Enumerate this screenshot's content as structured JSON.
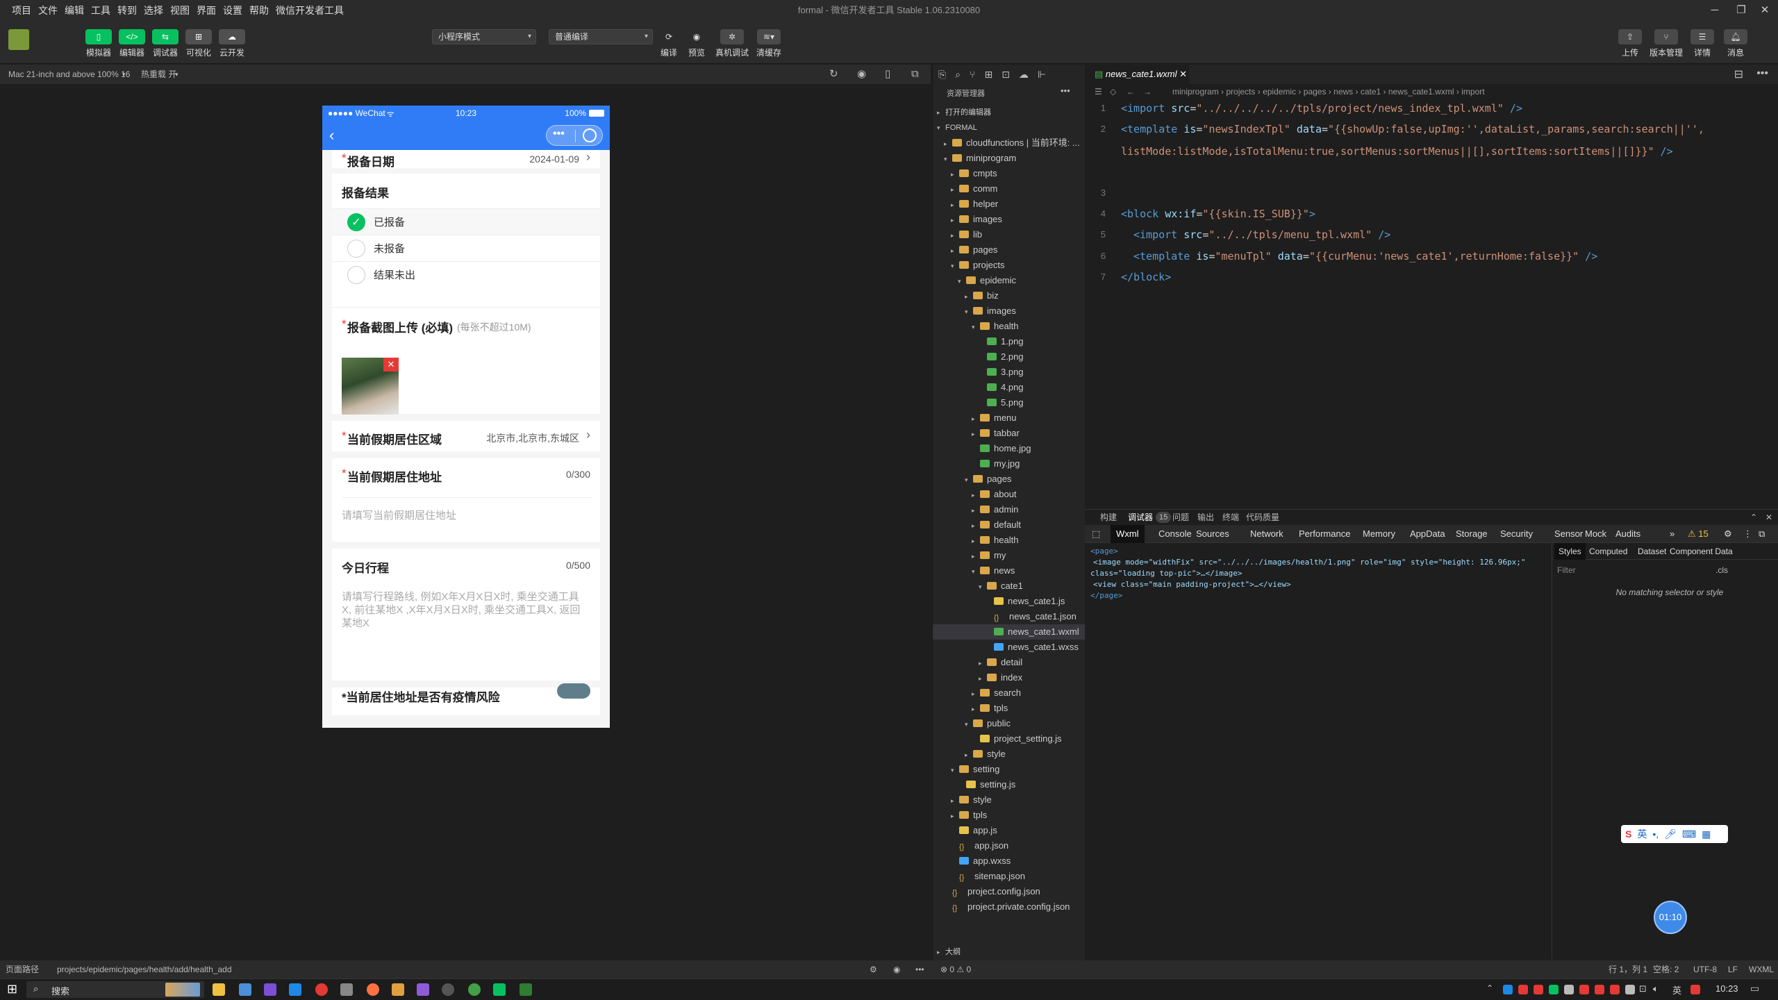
{
  "window": {
    "title": "formal - 微信开发者工具 Stable 1.06.2310080"
  },
  "menu": [
    "项目",
    "文件",
    "编辑",
    "工具",
    "转到",
    "选择",
    "视图",
    "界面",
    "设置",
    "帮助",
    "微信开发者工具"
  ],
  "toolbar": {
    "left_buttons": [
      "模拟器",
      "编辑器",
      "调试器",
      "可视化",
      "云开发"
    ],
    "mode_select": "小程序模式",
    "compile_select": "普通编译",
    "mid_buttons": [
      "编译",
      "预览",
      "真机调试",
      "清缓存"
    ],
    "right_buttons": [
      "上传",
      "版本管理",
      "详情",
      "消息"
    ]
  },
  "simbar": {
    "device": "Mac 21-inch and above 100% 16",
    "hotreload": "热重载 开"
  },
  "phone": {
    "carrier": "●●●●● WeChat",
    "time": "10:23",
    "battery": "100%",
    "date_label": "报备日期",
    "date_value": "2024-01-09",
    "result_label": "报备结果",
    "options": [
      "已报备",
      "未报备",
      "结果未出"
    ],
    "upload_label": "报备截图上传 (必填)",
    "upload_hint": "(每张不超过10M)",
    "region_label": "当前假期居住区域",
    "region_value": "北京市,北京市,东城区",
    "address_label": "当前假期居住地址",
    "address_count": "0/300",
    "address_placeholder": "请填写当前假期居住地址",
    "trip_label": "今日行程",
    "trip_count": "0/500",
    "trip_placeholder": "请填写行程路线, 例如X年X月X日X时, 乘坐交通工具X, 前往某地X ,X年X月X日X时, 乘坐交通工具X, 返回某地X",
    "bottom_partial": "*当前居住地址是否有疫情风险"
  },
  "explorer": {
    "title": "资源管理器",
    "open_editors": "打开的编辑器",
    "root": "FORMAL",
    "outline": "大纲",
    "tree": [
      {
        "d": 1,
        "name": "cloudfunctions | 当前环境: ...",
        "type": "folder",
        "open": false
      },
      {
        "d": 1,
        "name": "miniprogram",
        "type": "folder",
        "open": true
      },
      {
        "d": 2,
        "name": "cmpts",
        "type": "folder",
        "open": false
      },
      {
        "d": 2,
        "name": "comm",
        "type": "folder",
        "open": false
      },
      {
        "d": 2,
        "name": "helper",
        "type": "folder",
        "open": false
      },
      {
        "d": 2,
        "name": "images",
        "type": "folder",
        "open": false
      },
      {
        "d": 2,
        "name": "lib",
        "type": "folder",
        "open": false
      },
      {
        "d": 2,
        "name": "pages",
        "type": "folder",
        "open": false
      },
      {
        "d": 2,
        "name": "projects",
        "type": "folder",
        "open": true
      },
      {
        "d": 3,
        "name": "epidemic",
        "type": "folder",
        "open": true
      },
      {
        "d": 4,
        "name": "biz",
        "type": "folder",
        "open": false
      },
      {
        "d": 4,
        "name": "images",
        "type": "folder",
        "open": true
      },
      {
        "d": 5,
        "name": "health",
        "type": "folder",
        "open": true
      },
      {
        "d": 6,
        "name": "1.png",
        "type": "img"
      },
      {
        "d": 6,
        "name": "2.png",
        "type": "img"
      },
      {
        "d": 6,
        "name": "3.png",
        "type": "img"
      },
      {
        "d": 6,
        "name": "4.png",
        "type": "img"
      },
      {
        "d": 6,
        "name": "5.png",
        "type": "img"
      },
      {
        "d": 5,
        "name": "menu",
        "type": "folder",
        "open": false
      },
      {
        "d": 5,
        "name": "tabbar",
        "type": "folder",
        "open": false
      },
      {
        "d": 5,
        "name": "home.jpg",
        "type": "img"
      },
      {
        "d": 5,
        "name": "my.jpg",
        "type": "img"
      },
      {
        "d": 4,
        "name": "pages",
        "type": "folder",
        "open": true
      },
      {
        "d": 5,
        "name": "about",
        "type": "folder",
        "open": false
      },
      {
        "d": 5,
        "name": "admin",
        "type": "folder",
        "open": false
      },
      {
        "d": 5,
        "name": "default",
        "type": "folder",
        "open": false
      },
      {
        "d": 5,
        "name": "health",
        "type": "folder",
        "open": false
      },
      {
        "d": 5,
        "name": "my",
        "type": "folder",
        "open": false
      },
      {
        "d": 5,
        "name": "news",
        "type": "folder",
        "open": true
      },
      {
        "d": 6,
        "name": "cate1",
        "type": "folder",
        "open": true
      },
      {
        "d": 7,
        "name": "news_cate1.js",
        "type": "js"
      },
      {
        "d": 7,
        "name": "news_cate1.json",
        "type": "json"
      },
      {
        "d": 7,
        "name": "news_cate1.wxml",
        "type": "wxml",
        "selected": true
      },
      {
        "d": 7,
        "name": "news_cate1.wxss",
        "type": "wxss"
      },
      {
        "d": 6,
        "name": "detail",
        "type": "folder",
        "open": false
      },
      {
        "d": 6,
        "name": "index",
        "type": "folder",
        "open": false
      },
      {
        "d": 5,
        "name": "search",
        "type": "folder",
        "open": false
      },
      {
        "d": 5,
        "name": "tpls",
        "type": "folder",
        "open": false
      },
      {
        "d": 4,
        "name": "public",
        "type": "folder",
        "open": true
      },
      {
        "d": 5,
        "name": "project_setting.js",
        "type": "js"
      },
      {
        "d": 4,
        "name": "style",
        "type": "folder",
        "open": false
      },
      {
        "d": 2,
        "name": "setting",
        "type": "folder",
        "open": true
      },
      {
        "d": 3,
        "name": "setting.js",
        "type": "js"
      },
      {
        "d": 2,
        "name": "style",
        "type": "folder",
        "open": false
      },
      {
        "d": 2,
        "name": "tpls",
        "type": "folder",
        "open": false
      },
      {
        "d": 2,
        "name": "app.js",
        "type": "js"
      },
      {
        "d": 2,
        "name": "app.json",
        "type": "json"
      },
      {
        "d": 2,
        "name": "app.wxss",
        "type": "wxss"
      },
      {
        "d": 2,
        "name": "sitemap.json",
        "type": "json"
      },
      {
        "d": 1,
        "name": "project.config.json",
        "type": "json"
      },
      {
        "d": 1,
        "name": "project.private.config.json",
        "type": "json"
      }
    ]
  },
  "editor": {
    "tab": "news_cate1.wxml",
    "breadcrumb": [
      "miniprogram",
      "projects",
      "epidemic",
      "pages",
      "news",
      "cate1",
      "news_cate1.wxml",
      "import"
    ]
  },
  "devtools": {
    "top_tabs": [
      "构建",
      "调试器",
      "问题",
      "输出",
      "终端",
      "代码质量"
    ],
    "badge": "15",
    "tabs": [
      "Wxml",
      "Console",
      "Sources",
      "Network",
      "Performance",
      "Memory",
      "AppData",
      "Storage",
      "Security",
      "Sensor",
      "Mock",
      "Audits"
    ],
    "warn": "⚠ 15",
    "side_tabs": [
      "Styles",
      "Computed",
      "Dataset",
      "Component Data"
    ],
    "filter_placeholder": "Filter",
    "cls": ".cls",
    "no_match": "No matching selector or style",
    "wxml_lines": [
      "<page>",
      "<image mode=\"widthFix\" src=\"../../../images/health/1.png\" role=\"img\" style=\"height: 126.96px;\"",
      "class=\"loading top-pic\">…</image>",
      "<view class=\"main padding-project\">…</view>",
      "</page>"
    ]
  },
  "statusbar": {
    "path_label": "页面路径",
    "path": "projects/epidemic/pages/health/add/health_add",
    "problems": "⊗ 0 ⚠ 0",
    "pos": "行 1，列 1",
    "space": "空格: 2",
    "enc": "UTF-8",
    "eol": "LF",
    "lang": "WXML"
  },
  "taskbar": {
    "search": "搜索",
    "time": "10:23",
    "lang": "英"
  },
  "timer": "01:10",
  "ime": "英"
}
